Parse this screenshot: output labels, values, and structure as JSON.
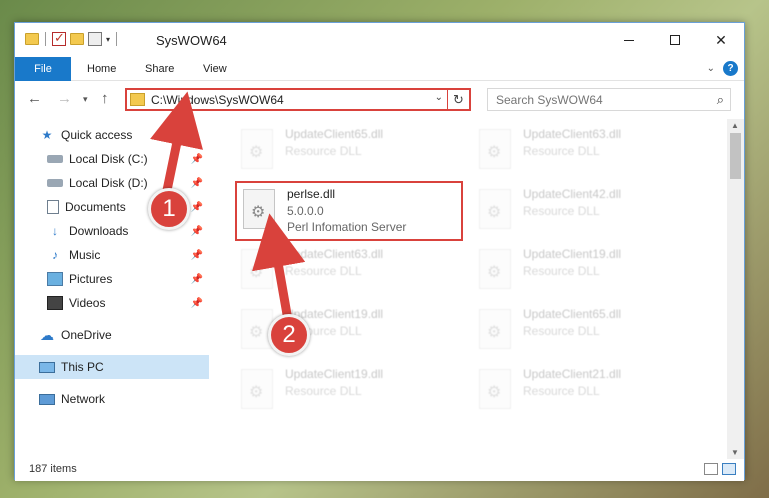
{
  "window": {
    "title": "SysWOW64"
  },
  "ribbon": {
    "tabs": [
      "File",
      "Home",
      "Share",
      "View"
    ],
    "help_label": "?"
  },
  "navigation": {
    "back_icon": "←",
    "forward_icon": "→",
    "recent_icon": "▾",
    "up_icon": "↑",
    "address_path": "C:\\Windows\\SysWOW64",
    "refresh_icon": "↻",
    "dropdown_icon": "⌄",
    "search_placeholder": "Search SysWOW64",
    "search_icon": "⌕"
  },
  "sidebar": {
    "items": [
      {
        "label": "Quick access",
        "icon": "star-icon",
        "pinned": false
      },
      {
        "label": "Local Disk (C:)",
        "icon": "disk-icon",
        "pinned": true
      },
      {
        "label": "Local Disk (D:)",
        "icon": "disk-icon",
        "pinned": true
      },
      {
        "label": "Documents",
        "icon": "document-icon",
        "pinned": true
      },
      {
        "label": "Downloads",
        "icon": "download-icon",
        "pinned": true
      },
      {
        "label": "Music",
        "icon": "music-icon",
        "pinned": true
      },
      {
        "label": "Pictures",
        "icon": "pictures-icon",
        "pinned": true
      },
      {
        "label": "Videos",
        "icon": "videos-icon",
        "pinned": true
      },
      {
        "label": "OneDrive",
        "icon": "cloud-icon",
        "pinned": false
      },
      {
        "label": "This PC",
        "icon": "computer-icon",
        "pinned": false,
        "selected": true
      },
      {
        "label": "Network",
        "icon": "network-icon",
        "pinned": false
      }
    ]
  },
  "files": [
    {
      "name": "UpdateClient65.dll",
      "type": "Resource DLL",
      "faded": true
    },
    {
      "name": "UpdateClient63.dll",
      "type": "Resource DLL",
      "faded": true
    },
    {
      "name": "perlse.dll",
      "version": "5.0.0.0",
      "description": "Perl Infomation Server",
      "faded": false,
      "highlighted": true
    },
    {
      "name": "UpdateClient42.dll",
      "type": "Resource DLL",
      "faded": true
    },
    {
      "name": "UpdateClient63.dll",
      "type": "Resource DLL",
      "faded": true
    },
    {
      "name": "UpdateClient19.dll",
      "type": "Resource DLL",
      "faded": true
    },
    {
      "name": "UpdateClient19.dll",
      "type": "Resource DLL",
      "faded": true
    },
    {
      "name": "UpdateClient65.dll",
      "type": "Resource DLL",
      "faded": true
    },
    {
      "name": "UpdateClient19.dll",
      "type": "Resource DLL",
      "faded": true
    },
    {
      "name": "UpdateClient21.dll",
      "type": "Resource DLL",
      "faded": true
    }
  ],
  "status": {
    "item_count": "187 items"
  },
  "annotations": {
    "step1": "1",
    "step2": "2",
    "color": "#d9423c"
  }
}
